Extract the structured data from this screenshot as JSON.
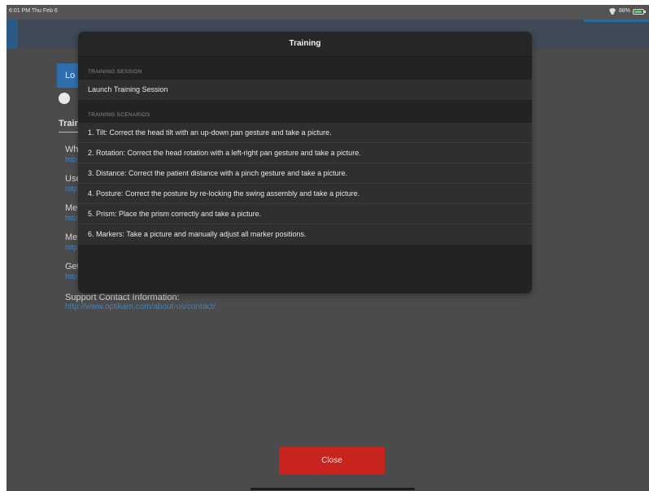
{
  "status_bar": {
    "time": "6:01 PM  Thu Feb 6",
    "battery": "88%"
  },
  "background": {
    "login_button_label": "Lo",
    "heading": "Train",
    "items": [
      {
        "label": "Wh",
        "link": "http"
      },
      {
        "label": "Use",
        "link": "http"
      },
      {
        "label": "Me",
        "link": "http"
      },
      {
        "label": "Me",
        "link": "http"
      },
      {
        "label": "Get",
        "link": "http"
      }
    ],
    "support_label": "Support Contact Information:",
    "support_link": "http://www.optikam.com/about-us/contact/"
  },
  "modal": {
    "title": "Training",
    "session_section": "TRAINING SESSION",
    "session_items": [
      "Launch Training Session"
    ],
    "scenarios_section": "TRAINING SCENARIOS",
    "scenarios": [
      "1. Tilt:  Correct the head tilt with an up-down pan gesture and take a picture.",
      "2. Rotation:  Correct the head rotation with a left-right pan gesture and take a picture.",
      "3. Distance:  Correct the patient distance with a pinch gesture and take a picture.",
      "4. Posture:  Correct the posture by re-locking the swing assembly and take a picture.",
      "5. Prism:  Place the prism correctly and take a picture.",
      "6. Markers:  Take a picture and manually adjust all marker positions."
    ]
  },
  "close_label": "Close",
  "colors": {
    "close": "#c8231e",
    "link": "#3d82c4",
    "modal_bg": "#232323"
  }
}
